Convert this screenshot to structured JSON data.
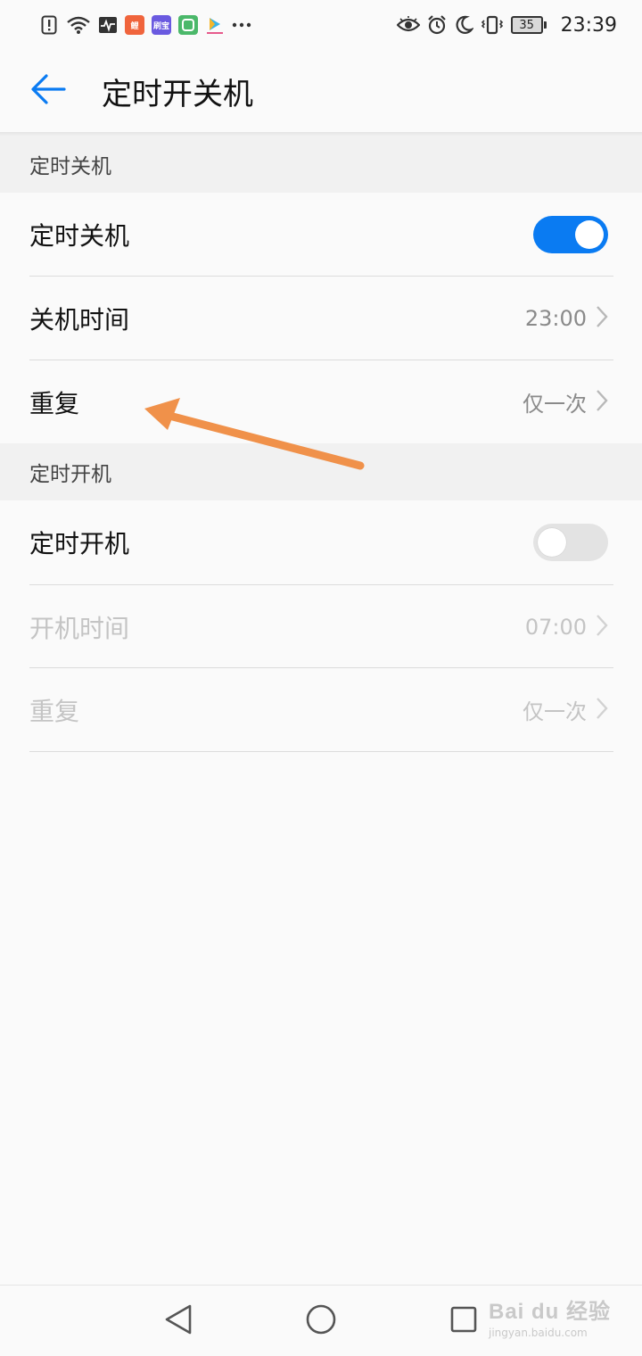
{
  "status_bar": {
    "time": "23:39",
    "battery_level": "35",
    "left_icons": [
      "sim-alert-icon",
      "wifi-icon",
      "activity-icon",
      "app-icon-1",
      "app-icon-2",
      "app-icon-3",
      "video-app-icon",
      "more-dots-icon"
    ],
    "right_icons": [
      "eye-comfort-icon",
      "alarm-icon",
      "do-not-disturb-moon-icon",
      "vibrate-icon",
      "battery-icon"
    ],
    "app_badges": [
      {
        "label": "鲤",
        "color": "#f0643c"
      },
      {
        "label": "刷宝",
        "color": "#6a5ae0"
      },
      {
        "label": "",
        "color": "#4bb86a"
      }
    ]
  },
  "app_bar": {
    "title": "定时开关机",
    "back_icon": "arrow-left-icon",
    "accent_color": "#0a7bf2"
  },
  "sections": [
    {
      "header": "定时关机",
      "rows": [
        {
          "label": "定时关机",
          "type": "toggle",
          "on": true
        },
        {
          "label": "关机时间",
          "type": "value",
          "value": "23:00"
        },
        {
          "label": "重复",
          "type": "value",
          "value": "仅一次"
        }
      ]
    },
    {
      "header": "定时开机",
      "rows": [
        {
          "label": "定时开机",
          "type": "toggle",
          "on": false
        },
        {
          "label": "开机时间",
          "type": "value",
          "value": "07:00",
          "disabled": true
        },
        {
          "label": "重复",
          "type": "value",
          "value": "仅一次",
          "disabled": true
        }
      ]
    }
  ],
  "annotation": {
    "color": "#f0914a",
    "icon": "orange-arrow-annotation"
  },
  "nav_bar": {
    "buttons": [
      "back-triangle-icon",
      "home-circle-icon",
      "recents-square-icon"
    ]
  },
  "watermark": {
    "logo": "Bai du 经验",
    "url": "jingyan.baidu.com"
  }
}
